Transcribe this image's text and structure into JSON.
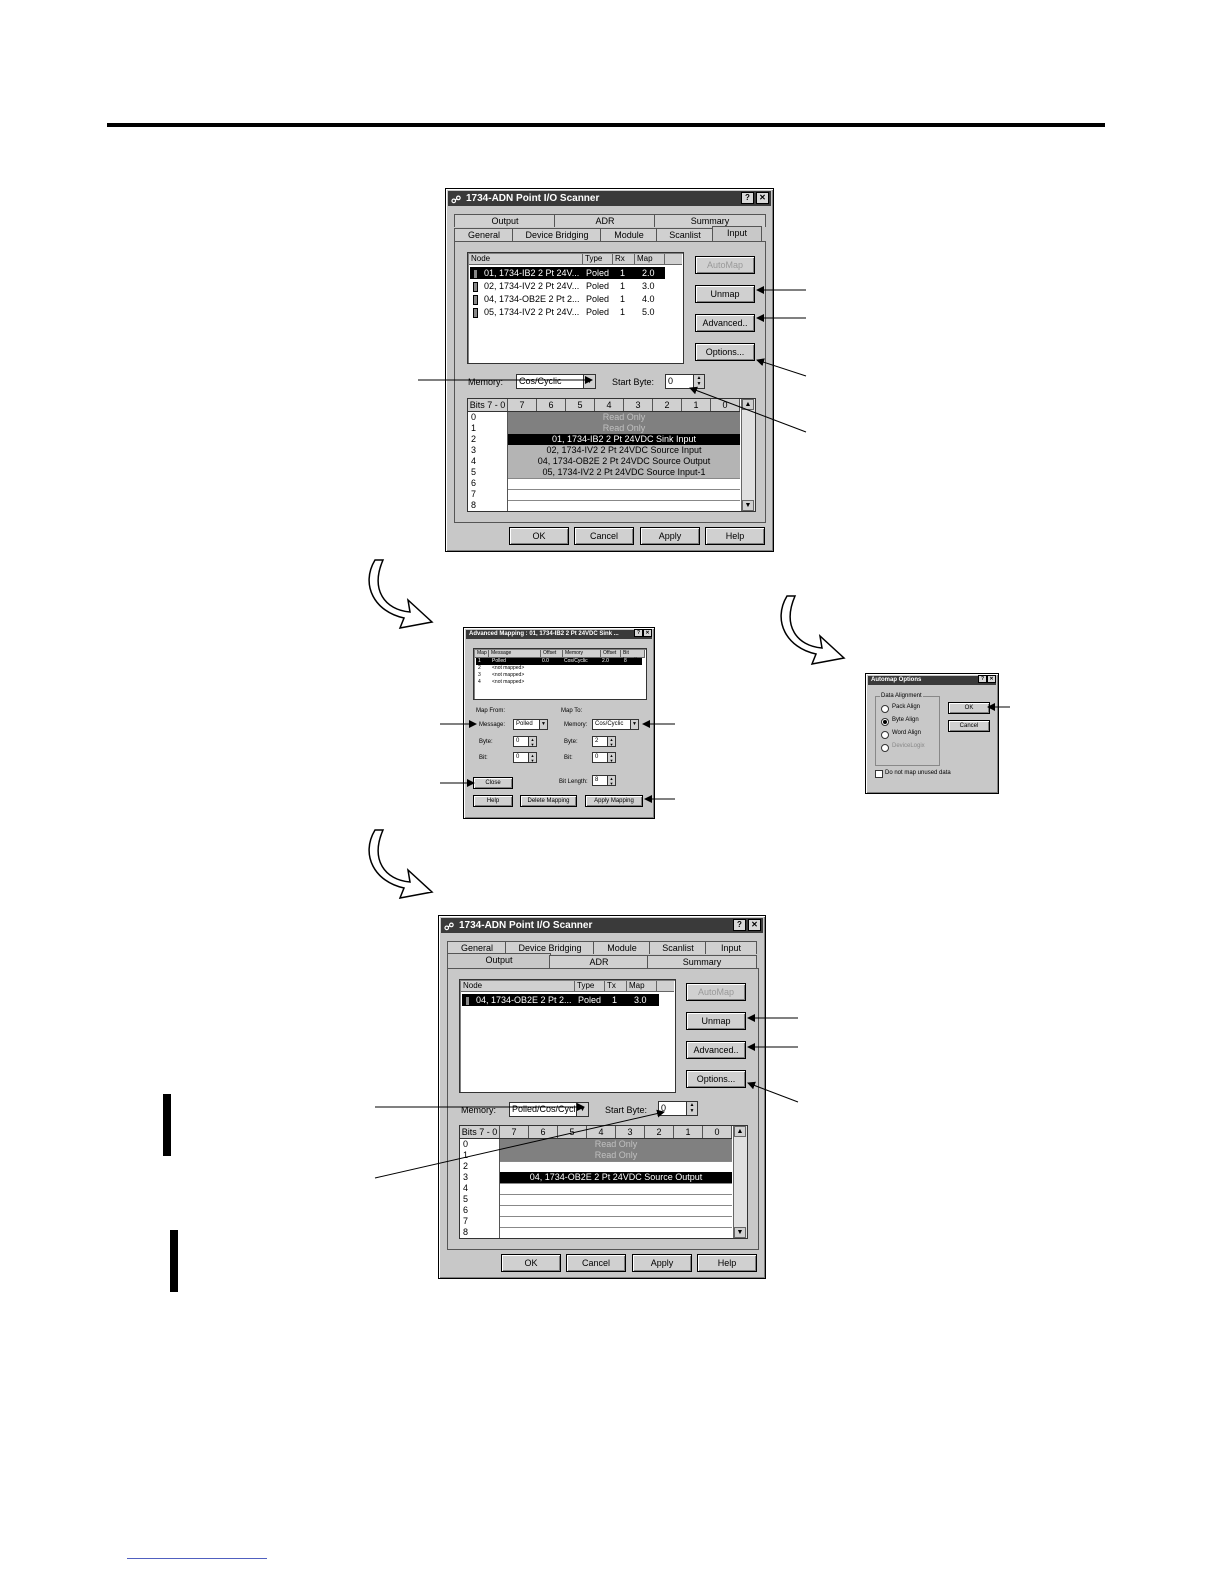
{
  "input_dialog": {
    "title": "1734-ADN Point I/O Scanner",
    "help_btn": "?",
    "close_btn": "✕",
    "tabs_row1": [
      "Output",
      "ADR",
      "Summary"
    ],
    "tabs_row2": [
      "General",
      "Device Bridging",
      "Module",
      "Scanlist",
      "Input"
    ],
    "columns": [
      "Node",
      "Type",
      "Rx",
      "Map"
    ],
    "rows": [
      {
        "node": "01, 1734-IB2 2 Pt 24V...",
        "type": "Poled",
        "size": "1",
        "map": "2.0"
      },
      {
        "node": "02, 1734-IV2 2 Pt 24V...",
        "type": "Poled",
        "size": "1",
        "map": "3.0"
      },
      {
        "node": "04, 1734-OB2E 2 Pt 2...",
        "type": "Poled",
        "size": "1",
        "map": "4.0"
      },
      {
        "node": "05, 1734-IV2 2 Pt 24V...",
        "type": "Poled",
        "size": "1",
        "map": "5.0"
      }
    ],
    "buttons": {
      "automap": "AutoMap",
      "unmap": "Unmap",
      "advanced": "Advanced..",
      "options": "Options..."
    },
    "memory_label": "Memory:",
    "memory_value": "Cos/Cyclic",
    "start_byte_label": "Start Byte:",
    "start_byte_value": "0",
    "grid_header": [
      "Bits 7 - 0",
      "7",
      "6",
      "5",
      "4",
      "3",
      "2",
      "1",
      "0"
    ],
    "grid_rows": [
      {
        "idx": "0",
        "text": "Read Only",
        "kind": "ro"
      },
      {
        "idx": "1",
        "text": "Read Only",
        "kind": "ro"
      },
      {
        "idx": "2",
        "text": "01, 1734-IB2 2 Pt 24VDC Sink Input",
        "kind": "sel"
      },
      {
        "idx": "3",
        "text": "02, 1734-IV2 2 Pt 24VDC Source Input",
        "kind": "map"
      },
      {
        "idx": "4",
        "text": "04, 1734-OB2E 2 Pt 24VDC Source Output",
        "kind": "map"
      },
      {
        "idx": "5",
        "text": "05, 1734-IV2 2 Pt 24VDC Source Input-1",
        "kind": "map"
      },
      {
        "idx": "6",
        "text": "",
        "kind": "empty"
      },
      {
        "idx": "7",
        "text": "",
        "kind": "empty"
      },
      {
        "idx": "8",
        "text": "",
        "kind": "empty"
      }
    ],
    "footer": {
      "ok": "OK",
      "cancel": "Cancel",
      "apply": "Apply",
      "help": "Help"
    }
  },
  "advanced_dialog": {
    "title": "Advanced Mapping : 01, 1734-IB2 2 Pt 24VDC Sink ...",
    "columns": [
      "Map",
      "Message",
      "Offset",
      "Memory",
      "Offset",
      "Bit Length"
    ],
    "rows": [
      {
        "map": "1",
        "message": "Polled",
        "offset": "0.0",
        "memory": "Cos/Cyclic",
        "offset2": "2.0",
        "length": "8",
        "selected": true
      },
      {
        "map": "2",
        "message": "<not mapped>",
        "offset": "",
        "memory": "",
        "offset2": "",
        "length": "",
        "selected": false
      },
      {
        "map": "3",
        "message": "<not mapped>",
        "offset": "",
        "memory": "",
        "offset2": "",
        "length": "",
        "selected": false
      },
      {
        "map": "4",
        "message": "<not mapped>",
        "offset": "",
        "memory": "",
        "offset2": "",
        "length": "",
        "selected": false
      }
    ],
    "map_from": "Map From:",
    "map_to": "Map To:",
    "message_label": "Message:",
    "message_value": "Polled",
    "from_byte_label": "Byte:",
    "from_byte_value": "0",
    "from_bit_label": "Bit:",
    "from_bit_value": "0",
    "memory_label": "Memory:",
    "memory_value": "Cos/Cyclic",
    "to_byte_label": "Byte:",
    "to_byte_value": "2",
    "to_bit_label": "Bit:",
    "to_bit_value": "0",
    "bit_length_label": "Bit Length:",
    "bit_length_value": "8",
    "close": "Close",
    "help": "Help",
    "delete_mapping": "Delete Mapping",
    "apply_mapping": "Apply Mapping"
  },
  "automap_dialog": {
    "title": "Automap Options",
    "group_label": "Data Alignment",
    "options": [
      "Pack Align",
      "Byte Align",
      "Word Align",
      "DeviceLogix"
    ],
    "selected_option": 1,
    "checkbox_label": "Do not map unused data",
    "ok": "OK",
    "cancel": "Cancel"
  },
  "output_dialog": {
    "title": "1734-ADN Point I/O Scanner",
    "help_btn": "?",
    "close_btn": "✕",
    "tabs_row1": [
      "General",
      "Device Bridging",
      "Module",
      "Scanlist",
      "Input"
    ],
    "tabs_row2": [
      "Output",
      "ADR",
      "Summary"
    ],
    "columns": [
      "Node",
      "Type",
      "Tx",
      "Map"
    ],
    "rows": [
      {
        "node": "04, 1734-OB2E 2 Pt 2...",
        "type": "Poled",
        "size": "1",
        "map": "3.0"
      }
    ],
    "buttons": {
      "automap": "AutoMap",
      "unmap": "Unmap",
      "advanced": "Advanced..",
      "options": "Options..."
    },
    "memory_label": "Memory:",
    "memory_value": "Polled/Cos/Cycl",
    "start_byte_label": "Start Byte:",
    "start_byte_value": "0",
    "grid_header": [
      "Bits 7 - 0",
      "7",
      "6",
      "5",
      "4",
      "3",
      "2",
      "1",
      "0"
    ],
    "grid_rows": [
      {
        "idx": "0",
        "text": "Read Only",
        "kind": "ro"
      },
      {
        "idx": "1",
        "text": "Read Only",
        "kind": "ro"
      },
      {
        "idx": "2",
        "text": "",
        "kind": "empty"
      },
      {
        "idx": "3",
        "text": "04, 1734-OB2E 2 Pt 24VDC Source Output",
        "kind": "sel"
      },
      {
        "idx": "4",
        "text": "",
        "kind": "empty"
      },
      {
        "idx": "5",
        "text": "",
        "kind": "empty"
      },
      {
        "idx": "6",
        "text": "",
        "kind": "empty"
      },
      {
        "idx": "7",
        "text": "",
        "kind": "empty"
      },
      {
        "idx": "8",
        "text": "",
        "kind": "empty"
      }
    ],
    "footer": {
      "ok": "OK",
      "cancel": "Cancel",
      "apply": "Apply",
      "help": "Help"
    }
  }
}
